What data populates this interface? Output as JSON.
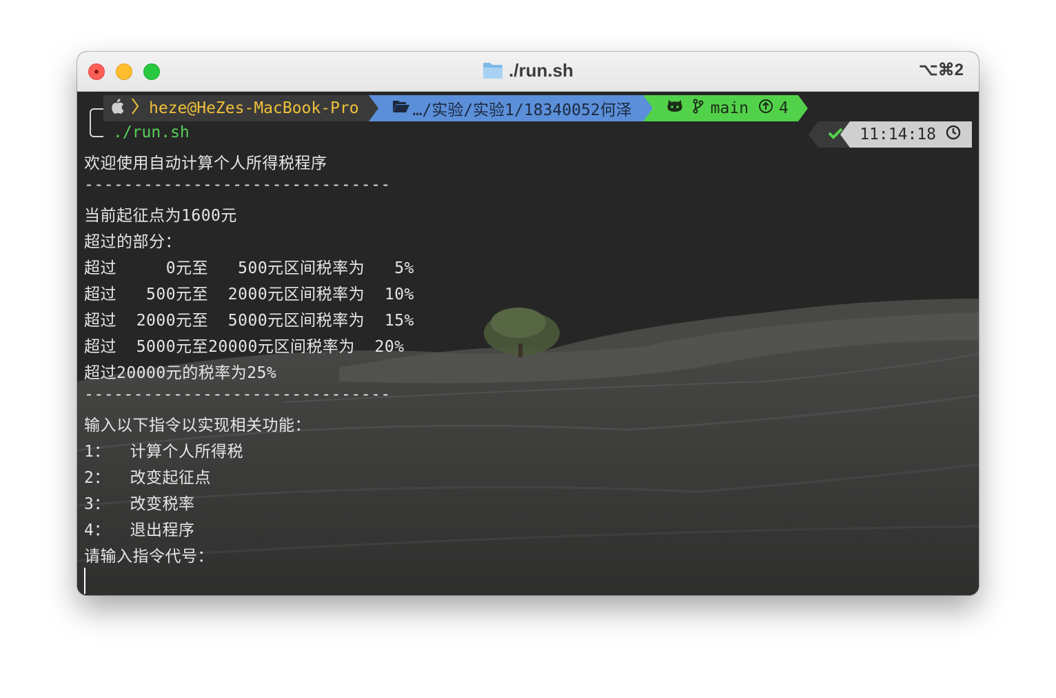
{
  "window": {
    "title": "./run.sh",
    "shortcut": "⌥⌘2",
    "title_icon": "folder-icon"
  },
  "prompt": {
    "user_host": "heze@HeZes-MacBook-Pro",
    "path": "…/实验/实验1/18340052何泽",
    "branch": "main",
    "ahead_count": "4",
    "command": "./run.sh",
    "status_time": "11:14:18",
    "icons": [
      "apple-icon",
      "chevron-right-icon",
      "folder-open-icon",
      "github-icon",
      "git-branch-icon",
      "arrow-up-circle-icon",
      "checkmark-icon",
      "clock-icon"
    ]
  },
  "output": {
    "lines": [
      "欢迎使用自动计算个人所得税程序",
      "-------------------------------",
      "当前起征点为1600元",
      "超过的部分：",
      "超过     0元至   500元区间税率为   5%",
      "超过   500元至  2000元区间税率为  10%",
      "超过  2000元至  5000元区间税率为  15%",
      "超过  5000元至20000元区间税率为  20%",
      "超过20000元的税率为25%",
      "-------------------------------",
      "输入以下指令以实现相关功能：",
      "1：  计算个人所得税",
      "2：  改变起征点",
      "3：  改变税率",
      "4：  退出程序",
      "请输入指令代号："
    ]
  },
  "colors": {
    "user_segment": "#3a3a3a",
    "user_text": "#f0c03a",
    "path_segment": "#5b8fd9",
    "git_segment": "#52d24a",
    "command_text": "#58d25a",
    "output_text": "#e6e6e6"
  }
}
